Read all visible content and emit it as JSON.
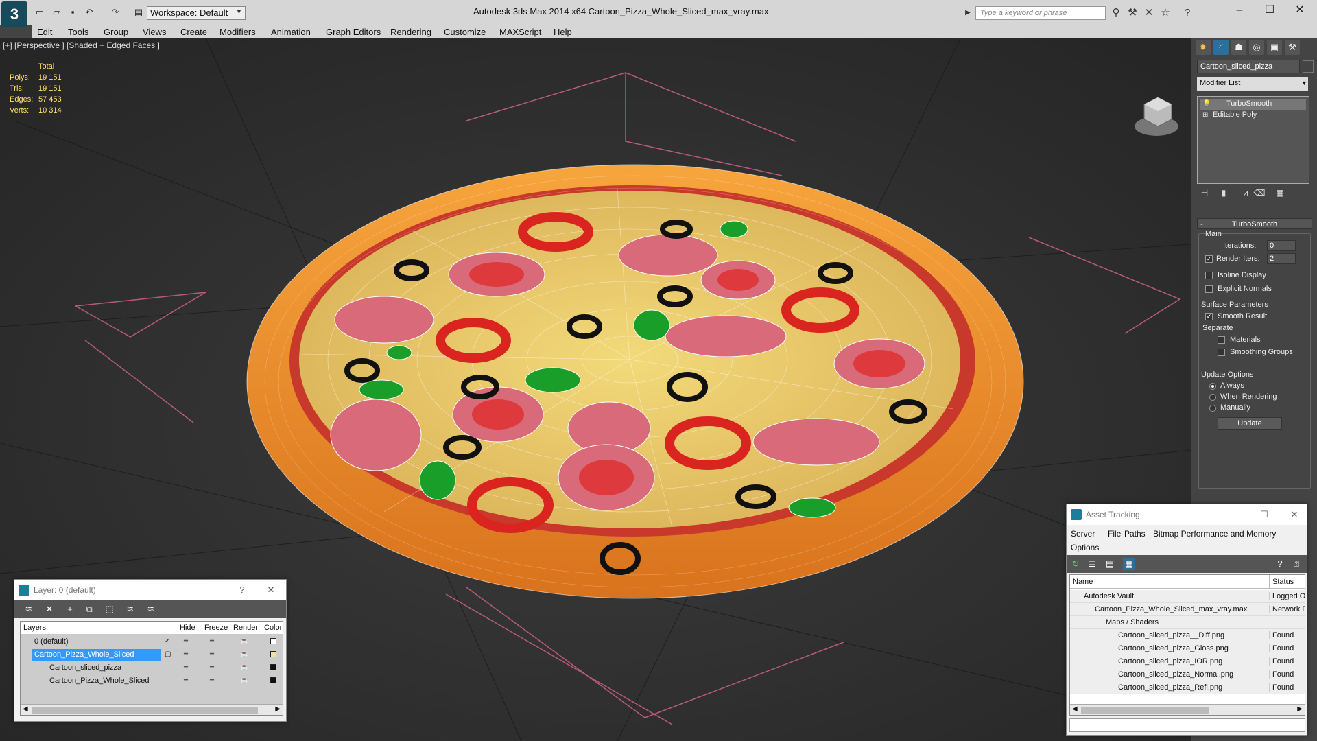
{
  "titlebar": {
    "workspace": "Workspace: Default",
    "app_title": "Autodesk 3ds Max  2014 x64     Cartoon_Pizza_Whole_Sliced_max_vray.max",
    "search_placeholder": "Type a keyword or phrase"
  },
  "menu": [
    "Edit",
    "Tools",
    "Group",
    "Views",
    "Create",
    "Modifiers",
    "Animation",
    "Graph Editors",
    "Rendering",
    "Customize",
    "MAXScript",
    "Help"
  ],
  "viewport": {
    "label": "[+] [Perspective ] [Shaded + Edged Faces ]",
    "stats": {
      "header": "Total",
      "rows": [
        {
          "k": "Polys:",
          "v": "19 151"
        },
        {
          "k": "Tris:",
          "v": "19 151"
        },
        {
          "k": "Edges:",
          "v": "57 453"
        },
        {
          "k": "Verts:",
          "v": "10 314"
        }
      ]
    }
  },
  "command_panel": {
    "object_name": "Cartoon_sliced_pizza",
    "modifier_list": "Modifier List",
    "stack": [
      "TurboSmooth",
      "Editable Poly"
    ],
    "turbosmooth": {
      "title": "TurboSmooth",
      "main": "Main",
      "iterations_label": "Iterations:",
      "iterations": "0",
      "render_iters_label": "Render Iters:",
      "render_iters": "2",
      "isoline": "Isoline Display",
      "explicit": "Explicit Normals",
      "surface": "Surface Parameters",
      "smooth_result": "Smooth Result",
      "separate": "Separate",
      "materials": "Materials",
      "smoothing_groups": "Smoothing Groups",
      "update_options": "Update Options",
      "always": "Always",
      "when_rendering": "When Rendering",
      "manually": "Manually",
      "update": "Update"
    }
  },
  "layer_panel": {
    "title": "Layer: 0 (default)",
    "columns": [
      "Layers",
      "Hide",
      "Freeze",
      "Render",
      "Color"
    ],
    "rows": [
      {
        "name": "0 (default)",
        "color": "#ffffff"
      },
      {
        "name": "Cartoon_Pizza_Whole_Sliced",
        "color": "#f0e0a0"
      },
      {
        "name": "Cartoon_sliced_pizza",
        "color": "#111111"
      },
      {
        "name": "Cartoon_Pizza_Whole_Sliced",
        "color": "#111111"
      }
    ]
  },
  "asset_panel": {
    "title": "Asset Tracking",
    "menu": [
      "Server",
      "File",
      "Paths",
      "Bitmap Performance and Memory",
      "Options"
    ],
    "columns": [
      "Name",
      "Status"
    ],
    "rows": [
      {
        "name": "Autodesk Vault",
        "status": "Logged O"
      },
      {
        "name": "Cartoon_Pizza_Whole_Sliced_max_vray.max",
        "status": "Network P"
      },
      {
        "name": "Maps / Shaders",
        "status": ""
      },
      {
        "name": "Cartoon_sliced_pizza__Diff.png",
        "status": "Found"
      },
      {
        "name": "Cartoon_sliced_pizza_Gloss.png",
        "status": "Found"
      },
      {
        "name": "Cartoon_sliced_pizza_IOR.png",
        "status": "Found"
      },
      {
        "name": "Cartoon_sliced_pizza_Normal.png",
        "status": "Found"
      },
      {
        "name": "Cartoon_sliced_pizza_Refl.png",
        "status": "Found"
      }
    ]
  }
}
